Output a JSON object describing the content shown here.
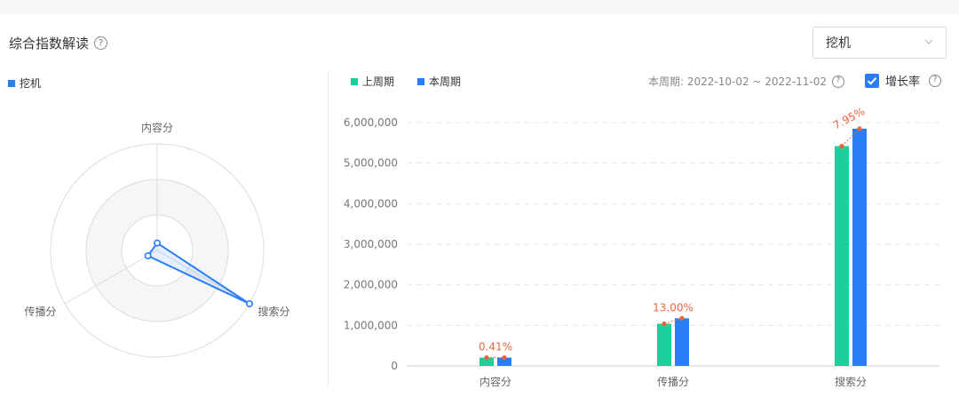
{
  "header": {
    "title": "综合指数解读",
    "help_glyph": "?",
    "select_value": "挖机"
  },
  "radar": {
    "legend": "挖机",
    "legend_color": "#2a7ef5",
    "axes": [
      "内容分",
      "搜索分",
      "传播分"
    ],
    "values": [
      0.07,
      1.0,
      0.1
    ]
  },
  "bar_panel": {
    "legend_prev": "上周期",
    "legend_curr": "本周期",
    "color_prev": "#1ecf9c",
    "color_curr": "#2a7ef5",
    "period_text": "本周期: 2022-10-02 ~ 2022-11-02",
    "growth_label": "增长率",
    "growth_checked": true,
    "growth_color": "#f0643c"
  },
  "chart_data": {
    "type": "bar",
    "categories": [
      "内容分",
      "传播分",
      "搜索分"
    ],
    "series": [
      {
        "name": "上周期",
        "values": [
          205000,
          1040000,
          5420000
        ]
      },
      {
        "name": "本周期",
        "values": [
          206000,
          1175000,
          5850000
        ]
      }
    ],
    "growth_rates": [
      "0.41%",
      "13.00%",
      "7.95%"
    ],
    "ylim": [
      0,
      6000000
    ],
    "yticks": [
      "0",
      "1,000,000",
      "2,000,000",
      "3,000,000",
      "4,000,000",
      "5,000,000",
      "6,000,000"
    ],
    "grid": true
  }
}
